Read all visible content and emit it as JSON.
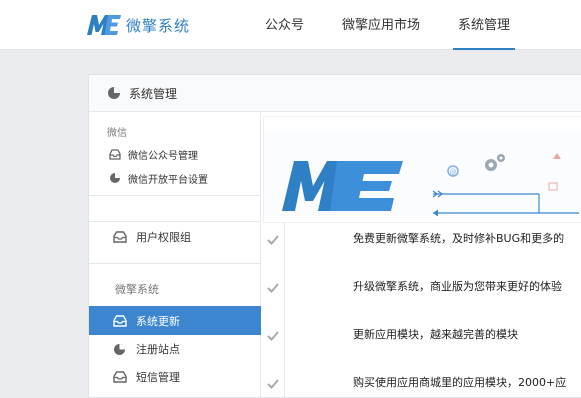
{
  "brand": {
    "logo_mark": "ME",
    "name": "微擎系统",
    "accent": "#2f7fc5",
    "active_bg": "#3b86cf"
  },
  "nav": {
    "items": [
      "公众号",
      "微擎应用市场",
      "系统管理"
    ],
    "active": 2
  },
  "panel": {
    "title": "系统管理",
    "title_icon": "pie-chart-icon"
  },
  "sidebar": {
    "group1": "微信",
    "wechat_items": [
      {
        "label": "微信公众号管理",
        "icon": "inbox-icon"
      },
      {
        "label": "微信开放平台设置",
        "icon": "pie-chart-icon"
      }
    ],
    "user_perm": {
      "label": "用户权限组",
      "icon": "inbox-icon"
    },
    "group2": "微擎系统",
    "system_items": [
      {
        "label": "系统更新",
        "icon": "inbox-icon",
        "active": true
      },
      {
        "label": "注册站点",
        "icon": "pie-chart-icon"
      },
      {
        "label": "短信管理",
        "icon": "inbox-icon"
      }
    ]
  },
  "banner": {
    "logo_mark": "ME"
  },
  "features": [
    "免费更新微擎系统，及时修补BUG和更多的",
    "升级微擎系统，商业版为您带来更好的体验",
    "更新应用模块，越来越完善的模块",
    "购买使用应用商城里的应用模块，2000+应"
  ]
}
